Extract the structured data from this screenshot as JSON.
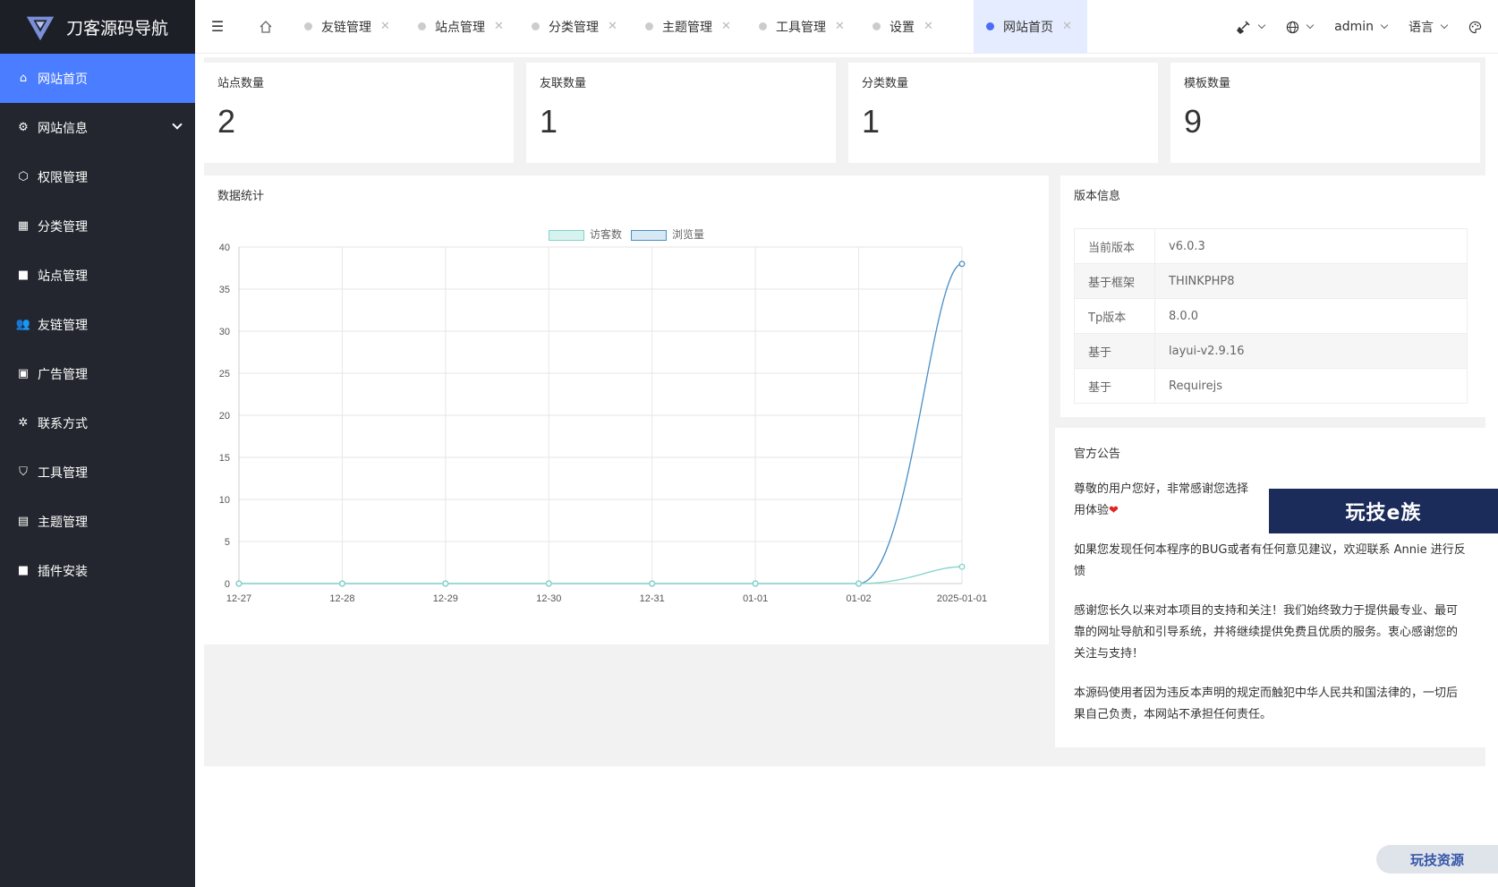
{
  "app": {
    "title": "刀客源码导航"
  },
  "sidebar": {
    "items": [
      {
        "label": "网站首页",
        "icon": "home-icon",
        "active": true
      },
      {
        "label": "网站信息",
        "icon": "gear-icon",
        "has_submenu": true
      },
      {
        "label": "权限管理",
        "icon": "cube-icon"
      },
      {
        "label": "分类管理",
        "icon": "apps-icon"
      },
      {
        "label": "站点管理",
        "icon": "windows-icon"
      },
      {
        "label": "友链管理",
        "icon": "users-icon"
      },
      {
        "label": "广告管理",
        "icon": "image-icon"
      },
      {
        "label": "联系方式",
        "icon": "cog-icon"
      },
      {
        "label": "工具管理",
        "icon": "shield-check-icon"
      },
      {
        "label": "主题管理",
        "icon": "calendar-icon"
      },
      {
        "label": "插件安装",
        "icon": "windows-icon"
      }
    ]
  },
  "header": {
    "tabs": [
      {
        "label": "友链管理",
        "active": false
      },
      {
        "label": "站点管理",
        "active": false
      },
      {
        "label": "分类管理",
        "active": false
      },
      {
        "label": "主题管理",
        "active": false
      },
      {
        "label": "工具管理",
        "active": false
      },
      {
        "label": "设置",
        "active": false
      },
      {
        "label": "网站首页",
        "active": true
      }
    ],
    "right": {
      "clear_icon": "broom-icon",
      "globe_icon": "globe-icon",
      "user": "admin",
      "language": "语言",
      "theme_icon": "palette-icon"
    }
  },
  "stats": [
    {
      "label": "站点数量",
      "value": "2"
    },
    {
      "label": "友联数量",
      "value": "1"
    },
    {
      "label": "分类数量",
      "value": "1"
    },
    {
      "label": "模板数量",
      "value": "9"
    }
  ],
  "chart_panel": {
    "title": "数据统计"
  },
  "chart_data": {
    "type": "line",
    "categories": [
      "12-27",
      "12-28",
      "12-29",
      "12-30",
      "12-31",
      "01-01",
      "01-02",
      "2025-01-01"
    ],
    "series": [
      {
        "name": "访客数",
        "values": [
          0,
          0,
          0,
          0,
          0,
          0,
          0,
          2
        ],
        "color": "#7fd3c8"
      },
      {
        "name": "浏览量",
        "values": [
          0,
          0,
          0,
          0,
          0,
          0,
          0,
          38
        ],
        "color": "#4a8fc4"
      }
    ],
    "ylim": [
      0,
      40
    ],
    "yticks": [
      0,
      5,
      10,
      15,
      20,
      25,
      30,
      35,
      40
    ],
    "grid": true,
    "legend": "top-center"
  },
  "version": {
    "title": "版本信息",
    "rows": [
      {
        "key": "当前版本",
        "value": "v6.0.3"
      },
      {
        "key": "基于框架",
        "value": "THINKPHP8"
      },
      {
        "key": "Tp版本",
        "value": "8.0.0"
      },
      {
        "key": "基于",
        "value": "layui-v2.9.16"
      },
      {
        "key": "基于",
        "value": "Requirejs"
      }
    ]
  },
  "notice": {
    "title": "官方公告",
    "p1": "尊敬的用户您好，非常感谢您选择",
    "p1b": "用体验",
    "p2": "如果您发现任何本程序的BUG或者有任何意见建议，欢迎联系 Annie 进行反馈",
    "p3": "感谢您长久以来对本项目的支持和关注！我们始终致力于提供最专业、最可靠的网址导航和引导系统，并将继续提供免费且优质的服务。衷心感谢您的关注与支持！",
    "p4": "本源码使用者因为违反本声明的规定而触犯中华人民共和国法律的，一切后果自己负责，本网站不承担任何责任。"
  },
  "watermarks": {
    "w1": "玩技e族",
    "w2": "玩技资源"
  }
}
